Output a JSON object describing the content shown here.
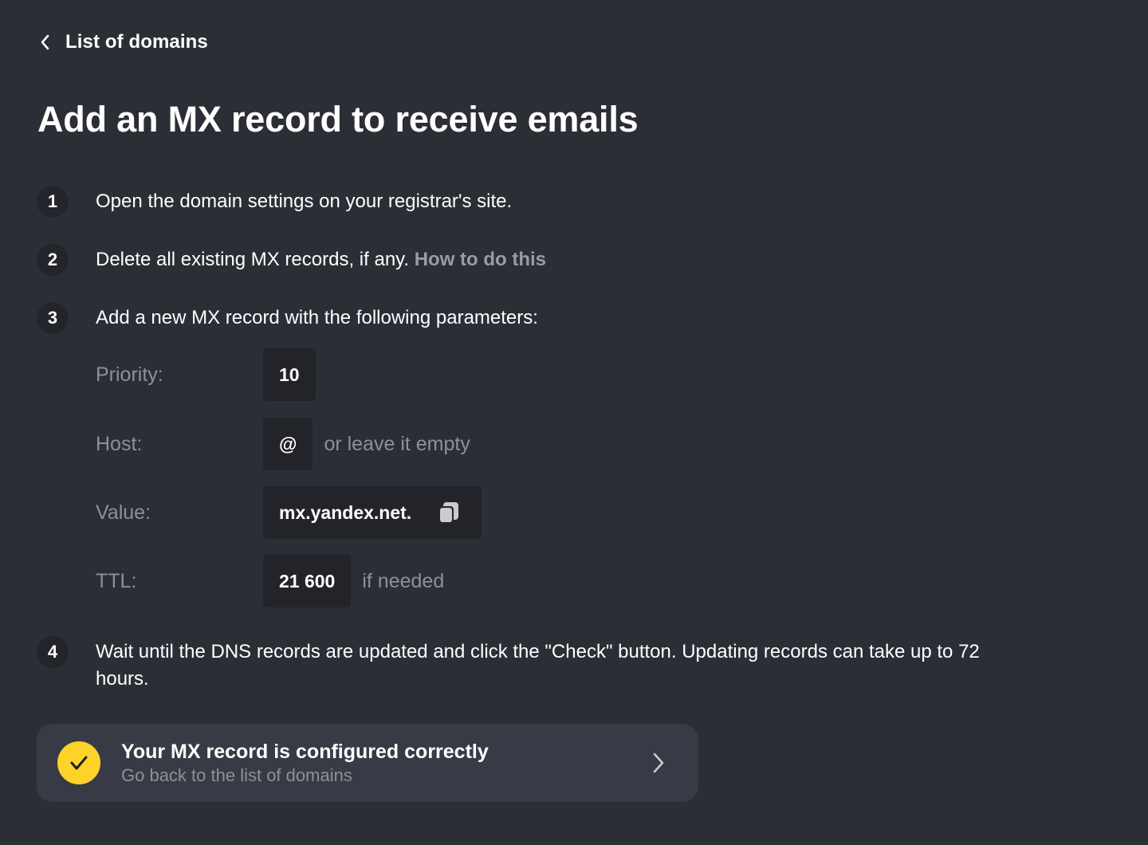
{
  "nav": {
    "back_label": "List of domains"
  },
  "page": {
    "title": "Add an MX record to receive emails"
  },
  "steps": [
    {
      "num": "1",
      "text": "Open the domain settings on your registrar's site."
    },
    {
      "num": "2",
      "text": "Delete all existing MX records, if any.",
      "link": "How to do this"
    },
    {
      "num": "3",
      "text": "Add a new MX record with the following parameters:"
    },
    {
      "num": "4",
      "text": "Wait until the DNS records are updated and click the \"Check\" button. Updating records can take up to 72 hours."
    }
  ],
  "params": {
    "priority": {
      "label": "Priority:",
      "value": "10"
    },
    "host": {
      "label": "Host:",
      "value": "@",
      "hint": "or leave it empty"
    },
    "value": {
      "label": "Value:",
      "value": "mx.yandex.net."
    },
    "ttl": {
      "label": "TTL:",
      "value": "21 600",
      "hint": "if needed"
    }
  },
  "status": {
    "title": "Your MX record is configured correctly",
    "subtitle": "Go back to the list of domains"
  },
  "icons": {
    "back": "chevron-left-icon",
    "copy": "copy-icon",
    "check": "check-icon",
    "forward": "chevron-right-icon"
  },
  "colors": {
    "background": "#2c2e36",
    "accent": "#fdd32a",
    "muted_text": "#8e9097",
    "link": "#9a9ca3",
    "field_bg": "#22242a",
    "card_bg": "#383b45"
  }
}
